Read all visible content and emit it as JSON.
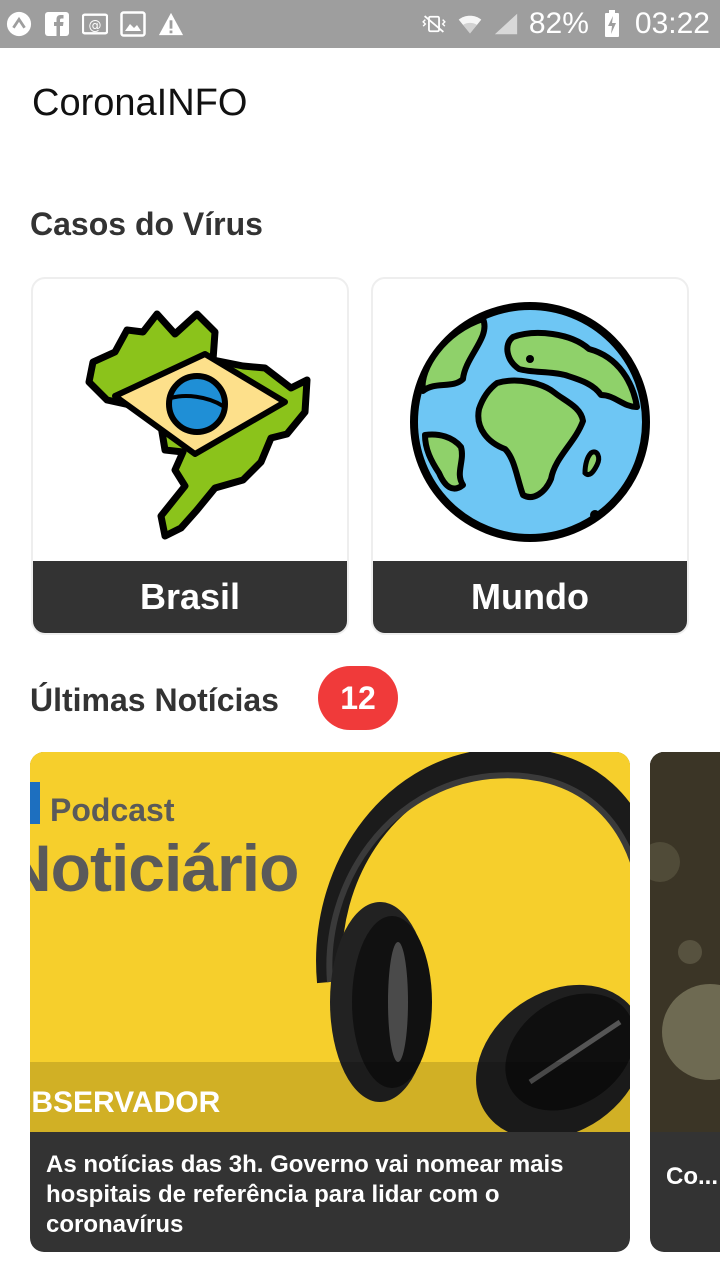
{
  "status_bar": {
    "battery": "82%",
    "time": "03:22"
  },
  "app": {
    "title": "CoronaINFO"
  },
  "cases_section": {
    "title": "Casos do Vírus",
    "cards": [
      {
        "label": "Brasil",
        "icon": "brazil-map-icon"
      },
      {
        "label": "Mundo",
        "icon": "globe-icon"
      }
    ]
  },
  "news_section": {
    "title": "Últimas Notícias",
    "count": "12",
    "items": [
      {
        "image_text_small": "Podcast",
        "image_text_big": "Noticiário",
        "image_brand": "OBSERVADOR",
        "caption": "As notícias das 3h. Governo vai nomear mais hospitais de referência para lidar com o coronavírus"
      },
      {
        "caption": "Co... qu..."
      }
    ]
  },
  "colors": {
    "status_bar": "#9e9e9e",
    "card_label_bg": "#333333",
    "badge": "#f03a3a",
    "podcast_yellow": "#f6cf2c"
  }
}
